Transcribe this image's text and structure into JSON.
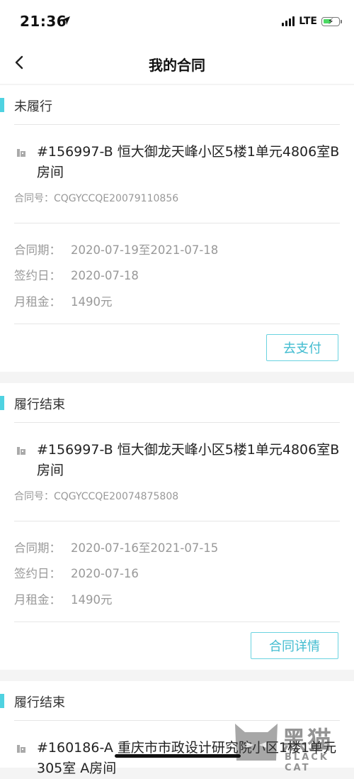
{
  "status": {
    "time": "21:36",
    "network": "LTE"
  },
  "nav": {
    "title": "我的合同"
  },
  "contracts": [
    {
      "status": "未履行",
      "address": "#156997-B 恒大御龙天峰小区5楼1单元4806室B房间",
      "contract_no": "合同号：CQGYCCQE20079110856",
      "period_label": "合同期：",
      "period": "2020-07-19至2021-07-18",
      "sign_label": "签约日：",
      "sign_date": "2020-07-18",
      "rent_label": "月租金：",
      "rent": "1490元",
      "button": "去支付"
    },
    {
      "status": "履行结束",
      "address": "#156997-B 恒大御龙天峰小区5楼1单元4806室B房间",
      "contract_no": "合同号：CQGYCCQE20074875808",
      "period_label": "合同期：",
      "period": "2020-07-16至2021-07-15",
      "sign_label": "签约日：",
      "sign_date": "2020-07-16",
      "rent_label": "月租金：",
      "rent": "1490元",
      "button": "合同详情"
    },
    {
      "status": "履行结束",
      "address": "#160186-A 重庆市市政设计研究院小区1楼1单元305室 A房间"
    }
  ],
  "watermark": {
    "cn": "黑猫",
    "en": "BLACK CAT"
  },
  "colors": {
    "accent": "#4fd2e1",
    "button": "#42bcd0"
  }
}
